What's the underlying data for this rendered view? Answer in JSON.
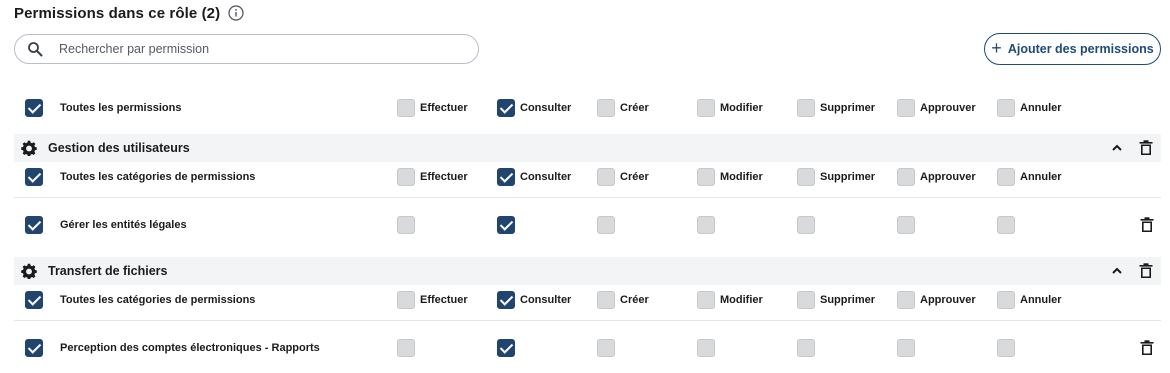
{
  "header": {
    "title": "Permissions dans ce rôle (2)",
    "info_icon": "info-icon"
  },
  "search": {
    "placeholder": "Rechercher par permission",
    "icon": "search-icon"
  },
  "add_button": {
    "label": "Ajouter des permissions"
  },
  "columns": [
    "Effectuer",
    "Consulter",
    "Créer",
    "Modifier",
    "Supprimer",
    "Approuver",
    "Annuler"
  ],
  "all_row": {
    "label": "Toutes les permissions",
    "checked": true,
    "values": [
      false,
      true,
      false,
      false,
      false,
      false,
      false
    ]
  },
  "sections": [
    {
      "title": "Gestion des utilisateurs",
      "all_label": "Toutes les catégories de permissions",
      "all_checked": true,
      "all_values": [
        false,
        true,
        false,
        false,
        false,
        false,
        false
      ],
      "items": [
        {
          "label": "Gérer les entités légales",
          "checked": true,
          "values": [
            false,
            true,
            false,
            false,
            false,
            false,
            false
          ]
        }
      ]
    },
    {
      "title": "Transfert de fichiers",
      "all_label": "Toutes les catégories de permissions",
      "all_checked": true,
      "all_values": [
        false,
        true,
        false,
        false,
        false,
        false,
        false
      ],
      "items": [
        {
          "label": "Perception des comptes électroniques - Rapports",
          "checked": true,
          "values": [
            false,
            true,
            false,
            false,
            false,
            false,
            false
          ]
        }
      ]
    }
  ]
}
